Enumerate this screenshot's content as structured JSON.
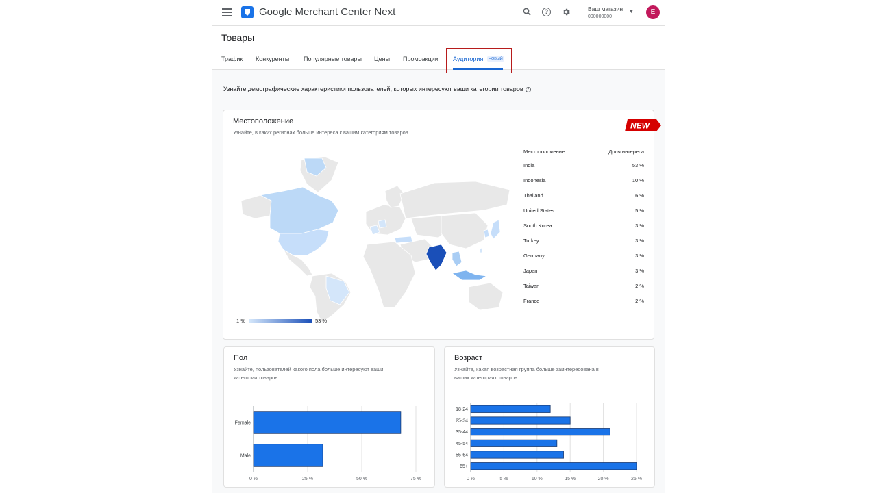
{
  "app": {
    "title": "Google Merchant Center Next"
  },
  "header": {
    "store_label": "Ваш магазин",
    "store_id": "000000000",
    "avatar_letter": "E",
    "avatar_color": "#c2185b"
  },
  "page": {
    "title": "Товары"
  },
  "tabs": [
    {
      "label": "Трафик"
    },
    {
      "label": "Конкуренты"
    },
    {
      "label": "Популярные товары"
    },
    {
      "label": "Цены"
    },
    {
      "label": "Промоакции"
    },
    {
      "label": "Аудитория",
      "badge": "НОВЫЙ",
      "active": true
    }
  ],
  "intro": {
    "text": "Узнайте демографические характеристики пользователей, которых интересуют ваши категории товаров"
  },
  "location_card": {
    "title": "Местоположение",
    "subtitle": "Узнайте, в каких регионах больше интереса к вашим категориям товаров",
    "new_label": "NEW",
    "table_headers": {
      "location": "Местоположение",
      "share": "Доля интереса"
    },
    "rows": [
      {
        "location": "India",
        "share": "53 %"
      },
      {
        "location": "Indonesia",
        "share": "10 %"
      },
      {
        "location": "Thailand",
        "share": "6 %"
      },
      {
        "location": "United States",
        "share": "5 %"
      },
      {
        "location": "South Korea",
        "share": "3 %"
      },
      {
        "location": "Turkey",
        "share": "3 %"
      },
      {
        "location": "Germany",
        "share": "3 %"
      },
      {
        "location": "Japan",
        "share": "3 %"
      },
      {
        "location": "Taiwan",
        "share": "2 %"
      },
      {
        "location": "France",
        "share": "2 %"
      }
    ],
    "legend_min": "1 %",
    "legend_max": "53 %"
  },
  "gender_card": {
    "title": "Пол",
    "subtitle_line1": "Узнайте, пользователей какого пола больше интересуют ваши",
    "subtitle_line2": "категории товаров"
  },
  "age_card": {
    "title": "Возраст",
    "subtitle_line1": "Узнайте, какая возрастная группа больше заинтересована в",
    "subtitle_line2": "ваших категориях товаров"
  },
  "colors": {
    "bar": "#1a73e8",
    "accent": "#1967d2",
    "highlight": "#b71c1c",
    "map_base": "#e8e8e8"
  },
  "chart_data": [
    {
      "type": "bar",
      "orientation": "horizontal",
      "categories": [
        "Female",
        "Male"
      ],
      "values": [
        68,
        32
      ],
      "xlim": [
        0,
        75
      ],
      "xticks": [
        "0 %",
        "25 %",
        "50 %",
        "75 %"
      ],
      "grid": true
    },
    {
      "type": "bar",
      "orientation": "horizontal",
      "categories": [
        "18-24",
        "25-34",
        "35-44",
        "45-54",
        "55-64",
        "65+"
      ],
      "values": [
        12,
        15,
        21,
        13,
        14,
        25
      ],
      "xlim": [
        0,
        25
      ],
      "xticks": [
        "0 %",
        "5 %",
        "10 %",
        "15 %",
        "20 %",
        "25 %"
      ],
      "grid": true
    }
  ]
}
